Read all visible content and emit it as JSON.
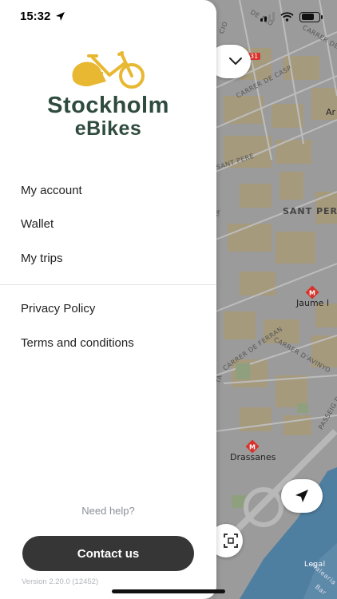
{
  "status_bar": {
    "time": "15:32"
  },
  "brand": {
    "line1": "Stockholm",
    "line2": "eBikes",
    "logo_color": "#e8b833",
    "text_color": "#2f4a3e"
  },
  "menu": {
    "primary": [
      {
        "label": "My account"
      },
      {
        "label": "Wallet"
      },
      {
        "label": "My trips"
      }
    ],
    "secondary": [
      {
        "label": "Privacy Policy"
      },
      {
        "label": "Terms and conditions"
      }
    ]
  },
  "footer": {
    "need_help": "Need help?",
    "contact_label": "Contact us",
    "version": "Version 2.20.0 (12452)"
  },
  "map": {
    "labels": {
      "street_top": "CIO",
      "street_flo": "DE FLO",
      "street_carder": "CARRER DE",
      "road_number": "31",
      "street_casp": "CARRER DE CASP",
      "street_ar": "Ar",
      "street_sant_pere": "SANT PERE",
      "district": "SANT PERE",
      "street_ia": "IA",
      "station_jaume": "Jaume I",
      "street_ferran": "CARRER DE FERRAN",
      "street_avinyo": "CARRER D'AVINYO",
      "street_ta": "TA",
      "street_passeig": "PASSEIG DE",
      "station_drassanes": "Drassanes",
      "legal": "Legal",
      "street_bar": "Bar",
      "street_marina": "Malearia"
    },
    "metro_color": "#d9322b"
  }
}
